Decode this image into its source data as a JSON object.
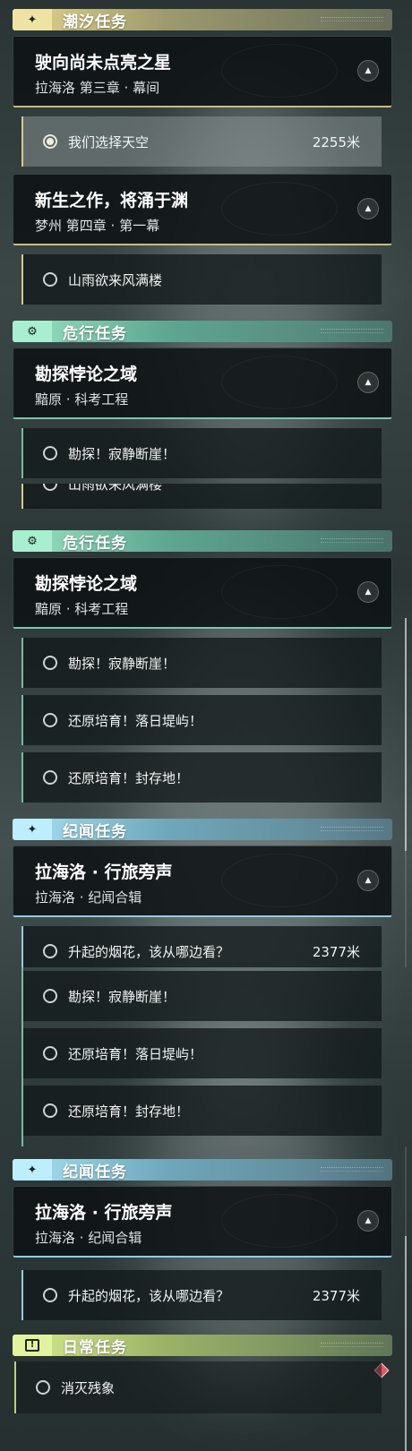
{
  "panels": [
    {
      "categories": [
        {
          "icon": "four-point-star-icon",
          "glyph": "✦",
          "label": "潮汐任务",
          "theme": "gold"
        },
        {
          "icon": "gear-eye-icon",
          "glyph": "⚙",
          "label": "危行任务",
          "theme": "teal"
        }
      ],
      "quests": [
        {
          "title": "驶向尚未点亮之星",
          "subtitle": "拉海洛 第三章 · 幕间"
        },
        {
          "title": "新生之作，将涌于渊",
          "subtitle": "梦州 第四章 · 第一幕"
        },
        {
          "title": "勘探悖论之域",
          "subtitle": "黯原 · 科考工程"
        }
      ],
      "items": [
        {
          "text": "我们选择天空",
          "distance": "2255米"
        },
        {
          "text": "山雨欲来风满楼"
        },
        {
          "text": "勘探！寂静断崖！"
        }
      ]
    },
    {
      "categories": [
        {
          "icon": "gear-eye-icon",
          "glyph": "⚙",
          "label": "危行任务",
          "theme": "teal"
        },
        {
          "icon": "four-point-star-icon",
          "glyph": "✦",
          "label": "纪闻任务",
          "theme": "blue"
        }
      ],
      "quests": [
        {
          "title": "勘探悖论之域",
          "subtitle": "黯原 · 科考工程"
        },
        {
          "title": "拉海洛 · 行旅旁声",
          "subtitle": "拉海洛 · 纪闻合辑"
        }
      ],
      "items": [
        {
          "text": "山雨欲来风满楼"
        },
        {
          "text": "勘探！寂静断崖！"
        },
        {
          "text": "还原培育！落日堤屿！"
        },
        {
          "text": "还原培育！封存地！"
        },
        {
          "text": "升起的烟花，该从哪边看？",
          "distance": "2377米"
        }
      ]
    },
    {
      "categories": [
        {
          "icon": "four-point-star-icon",
          "glyph": "✦",
          "label": "纪闻任务",
          "theme": "blue"
        },
        {
          "icon": "exclamation-icon",
          "glyph": "!",
          "label": "日常任务",
          "theme": "lime"
        }
      ],
      "quests": [
        {
          "title": "拉海洛 · 行旅旁声",
          "subtitle": "拉海洛 · 纪闻合辑"
        }
      ],
      "items": [
        {
          "text": "勘探！寂静断崖！"
        },
        {
          "text": "还原培育！落日堤屿！"
        },
        {
          "text": "还原培育！封存地！"
        },
        {
          "text": "升起的烟花，该从哪边看？",
          "distance": "2377米"
        },
        {
          "text": "消灭残象"
        }
      ]
    }
  ],
  "colors": {
    "gold": "#d8ca7e",
    "teal": "#6fbf9f",
    "blue": "#8ecfe2",
    "lime": "#b9d36f",
    "marker": "#e05868"
  }
}
